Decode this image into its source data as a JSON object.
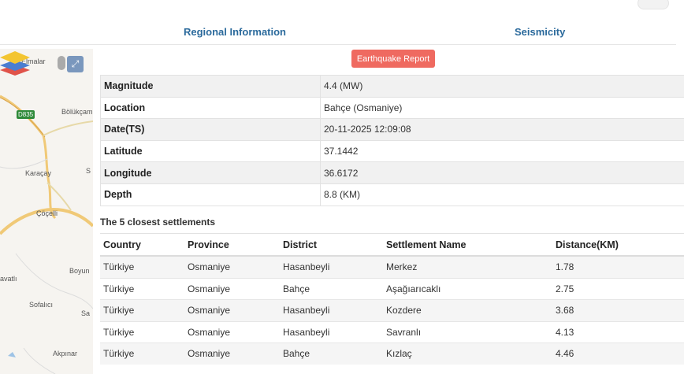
{
  "tabs": {
    "regional": "Regional Information",
    "seismicity": "Seismicity"
  },
  "report_button": "Earthquake Report",
  "map": {
    "labels": [
      "Elmalar",
      "Bölükçam",
      "Karaçay",
      "Çöçelli",
      "Boyun",
      "avatlı",
      "Sofalıcı",
      "Sa",
      "Akpınar",
      "S"
    ],
    "road_badge": "D835",
    "expand_icon": "expand-arrows-icon",
    "layers_icon": "layers-icon"
  },
  "info": {
    "rows": [
      {
        "key": "Magnitude",
        "value": "4.4 (MW)"
      },
      {
        "key": "Location",
        "value": "Bahçe (Osmaniye)"
      },
      {
        "key": "Date(TS)",
        "value": "20-11-2025 12:09:08"
      },
      {
        "key": "Latitude",
        "value": "37.1442"
      },
      {
        "key": "Longitude",
        "value": "36.6172"
      },
      {
        "key": "Depth",
        "value": "8.8 (KM)"
      }
    ]
  },
  "settlements": {
    "title": "The 5 closest settlements",
    "headers": [
      "Country",
      "Province",
      "District",
      "Settlement Name",
      "Distance(KM)"
    ],
    "rows": [
      [
        "Türkiye",
        "Osmaniye",
        "Hasanbeyli",
        "Merkez",
        "1.78"
      ],
      [
        "Türkiye",
        "Osmaniye",
        "Bahçe",
        "Aşağıarıcaklı",
        "2.75"
      ],
      [
        "Türkiye",
        "Osmaniye",
        "Hasanbeyli",
        "Kozdere",
        "3.68"
      ],
      [
        "Türkiye",
        "Osmaniye",
        "Hasanbeyli",
        "Savranlı",
        "4.13"
      ],
      [
        "Türkiye",
        "Osmaniye",
        "Bahçe",
        "Kızlaç",
        "4.46"
      ]
    ]
  },
  "colors": {
    "tab_text": "#2b6a9c",
    "report_button": "#ef6a60",
    "stripe": "#f1f1f1"
  }
}
